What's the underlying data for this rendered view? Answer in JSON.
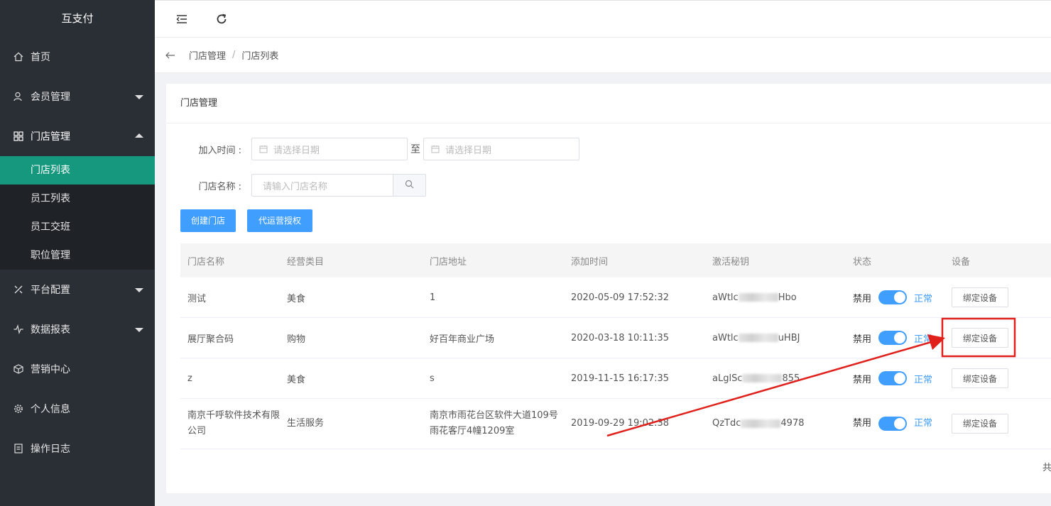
{
  "app": {
    "title": "互支付"
  },
  "sidebar": {
    "items": [
      {
        "label": "首页",
        "icon": "home-icon"
      },
      {
        "label": "会员管理",
        "icon": "user-icon"
      },
      {
        "label": "门店管理",
        "icon": "store-icon"
      },
      {
        "label": "平台配置",
        "icon": "tools-icon"
      },
      {
        "label": "数据报表",
        "icon": "pulse-icon"
      },
      {
        "label": "营销中心",
        "icon": "cube-icon"
      },
      {
        "label": "个人信息",
        "icon": "gear-icon"
      },
      {
        "label": "操作日志",
        "icon": "log-icon"
      }
    ],
    "submenu": [
      "门店列表",
      "员工列表",
      "员工交班",
      "职位管理"
    ]
  },
  "breadcrumb": {
    "parent": "门店管理",
    "sep": "/",
    "current": "门店列表"
  },
  "card": {
    "title": "门店管理"
  },
  "filters": {
    "join_time_label": "加入时间 :",
    "date_placeholder_start": "请选择日期",
    "range_sep": "至",
    "date_placeholder_end": "请选择日期",
    "store_name_label": "门店名称 :",
    "store_name_placeholder": "请输入门店名称"
  },
  "actions": {
    "create": "创建门店",
    "authorize": "代运营授权"
  },
  "table": {
    "headers": [
      "门店名称",
      "经营类目",
      "门店地址",
      "添加时间",
      "激活秘钥",
      "状态",
      "设备"
    ],
    "rows": [
      {
        "name": "测试",
        "category": "美食",
        "address": "1",
        "time": "2020-05-09 17:52:32",
        "key_prefix": "aWtlc",
        "key_suffix": "Hbo"
      },
      {
        "name": "展厅聚合码",
        "category": "购物",
        "address": "好百年商业广场",
        "time": "2020-03-18 10:11:35",
        "key_prefix": "aWtlc",
        "key_suffix": "uHBJ"
      },
      {
        "name": "z",
        "category": "美食",
        "address": "s",
        "time": "2019-11-15 16:17:35",
        "key_prefix": "aLglSc",
        "key_suffix": "855"
      },
      {
        "name": "南京千呼软件技术有限公司",
        "category": "生活服务",
        "address": "南京市雨花台区软件大道109号雨花客厅4幢1209室",
        "time": "2019-09-29 19:02:38",
        "key_prefix": "QzTdc",
        "key_suffix": "4978"
      }
    ],
    "status_off": "禁用",
    "status_on": "正常",
    "bind_label": "绑定设备"
  },
  "pager": {
    "text": "共"
  },
  "colors": {
    "accent": "#409eff",
    "sidebar": "#2a2f35",
    "active_menu": "#16987e",
    "annotation": "#e0201b"
  }
}
